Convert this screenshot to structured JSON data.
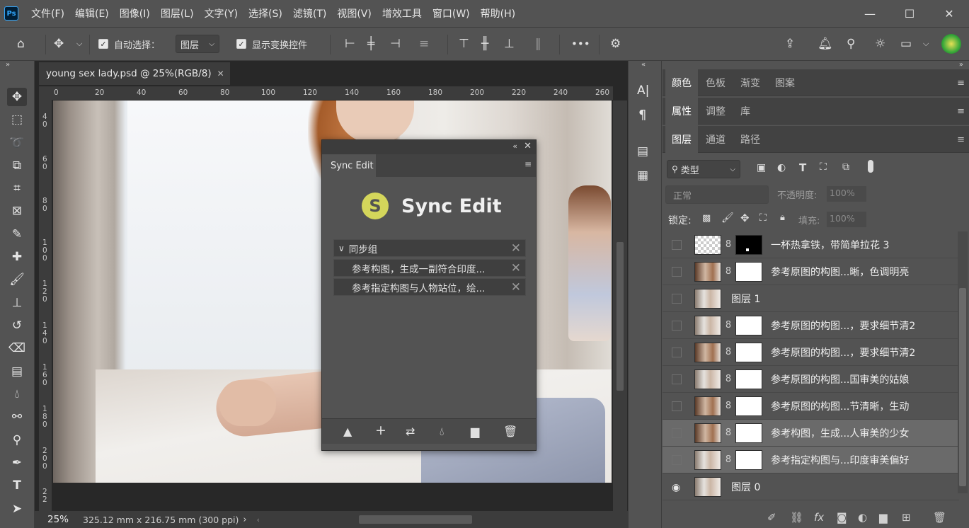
{
  "menubar": {
    "logo": "Ps",
    "items": [
      "文件(F)",
      "编辑(E)",
      "图像(I)",
      "图层(L)",
      "文字(Y)",
      "选择(S)",
      "滤镜(T)",
      "视图(V)",
      "增效工具",
      "窗口(W)",
      "帮助(H)"
    ],
    "minimize": "—",
    "maximize": "☐",
    "close": "✕"
  },
  "options": {
    "auto_select_label": "自动选择：",
    "auto_select_value": "图层",
    "show_transform_label": "显示变换控件",
    "more": "•••"
  },
  "document": {
    "tab_title": "young sex lady.psd @ 25%(RGB/8)",
    "tab_close": "✕",
    "ruler_h": [
      "0",
      "20",
      "40",
      "60",
      "80",
      "100",
      "120",
      "140",
      "160",
      "180",
      "200",
      "220",
      "240",
      "260"
    ],
    "ruler_v": [
      "4\n0",
      "6\n0",
      "8\n0",
      "1\n0\n0",
      "1\n2\n0",
      "1\n4\n0",
      "1\n6\n0",
      "1\n8\n0",
      "2\n0\n0",
      "2\n2"
    ],
    "zoom": "25%",
    "size_info": "325.12 mm x 216.75 mm (300 ppi)",
    "status_arrow": "›"
  },
  "sync_edit": {
    "tab": "Sync Edit",
    "logo_text": "Sync Edit",
    "group_label": "同步组",
    "items": [
      "参考构图，生成一副符合印度...",
      "参考指定构图与人物站位，绘..."
    ]
  },
  "panels": {
    "row1_tabs": [
      "颜色",
      "色板",
      "渐变",
      "图案"
    ],
    "row2_tabs": [
      "属性",
      "调整",
      "库"
    ],
    "row3_tabs": [
      "图层",
      "通道",
      "路径"
    ],
    "filter_label": "类型",
    "blend_mode": "正常",
    "opacity_label": "不透明度:",
    "opacity_value": "100%",
    "lock_label": "锁定:",
    "fill_label": "填充:",
    "fill_value": "100%",
    "layers": [
      {
        "name": "一杯热拿铁，带简单拉花 3",
        "thumb": "checker",
        "mask": "black"
      },
      {
        "name": "参考原图的构图...晰，色调明亮",
        "thumb": "photo2",
        "mask": "white"
      },
      {
        "name": "图层 1",
        "thumb": "photo",
        "mask": "none"
      },
      {
        "name": "参考原图的构图...，要求细节清2",
        "thumb": "photo",
        "mask": "white"
      },
      {
        "name": "参考原图的构图...，要求细节清2",
        "thumb": "photo2",
        "mask": "white"
      },
      {
        "name": "参考原图的构图...国审美的姑娘",
        "thumb": "photo",
        "mask": "white"
      },
      {
        "name": "参考原图的构图...节清晰，生动",
        "thumb": "photo2",
        "mask": "white"
      },
      {
        "name": "参考构图，生成...人审美的少女",
        "thumb": "photo2",
        "mask": "white"
      },
      {
        "name": "参考指定构图与...印度审美偏好",
        "thumb": "photo",
        "mask": "white"
      },
      {
        "name": "图层 0",
        "thumb": "photo",
        "mask": "none"
      }
    ]
  }
}
